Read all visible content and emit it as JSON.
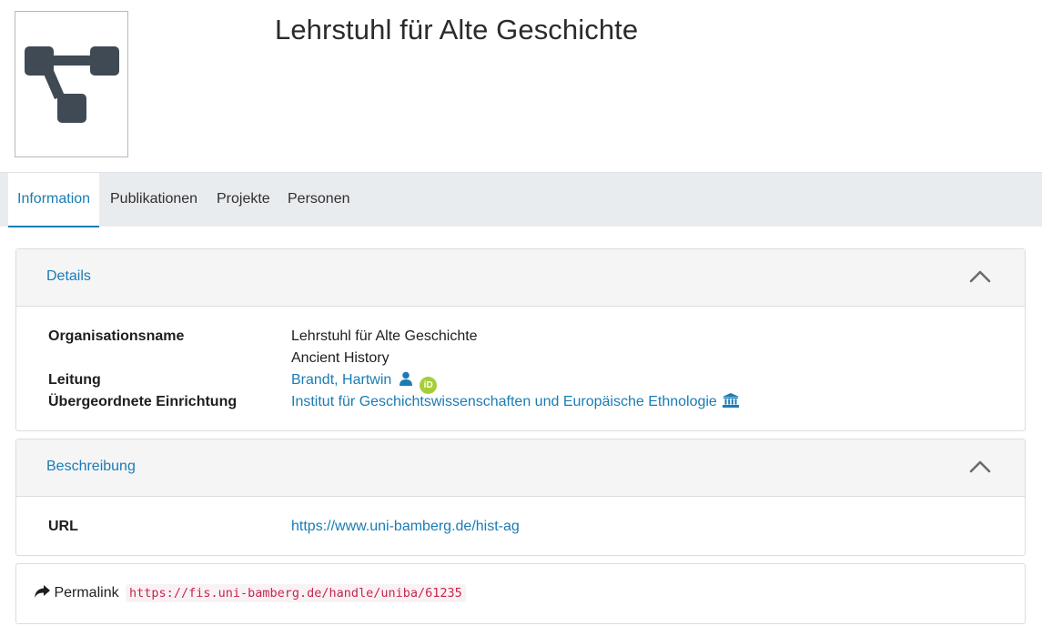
{
  "header": {
    "title": "Lehrstuhl für Alte Geschichte",
    "logo_icon": "org-structure-icon"
  },
  "tabs": [
    {
      "label": "Information",
      "active": true
    },
    {
      "label": "Publikationen",
      "active": false
    },
    {
      "label": "Projekte",
      "active": false
    },
    {
      "label": "Personen",
      "active": false
    }
  ],
  "details": {
    "heading": "Details",
    "organisationsname_label": "Organisationsname",
    "organisationsname_value_de": "Lehrstuhl für Alte Geschichte",
    "organisationsname_value_en": "Ancient History",
    "leitung_label": "Leitung",
    "leitung_value": "Brandt, Hartwin",
    "orcid_text": "iD",
    "einrichtung_label": "Übergeordnete Einrichtung",
    "einrichtung_value": "Institut für Geschichtswissenschaften und Europäische Ethnologie"
  },
  "beschreibung": {
    "heading": "Beschreibung",
    "url_label": "URL",
    "url_value": "https://www.uni-bamberg.de/hist-ag"
  },
  "permalink": {
    "label": "Permalink",
    "value": "https://fis.uni-bamberg.de/handle/uniba/61235"
  },
  "colors": {
    "link": "#1a7cb4",
    "tabbar_bg": "#e9ecef",
    "card_head_bg": "#f5f5f5",
    "orcid_green": "#a6ce39",
    "code_red": "#c7254e",
    "logo_gray": "#3f4a55"
  }
}
